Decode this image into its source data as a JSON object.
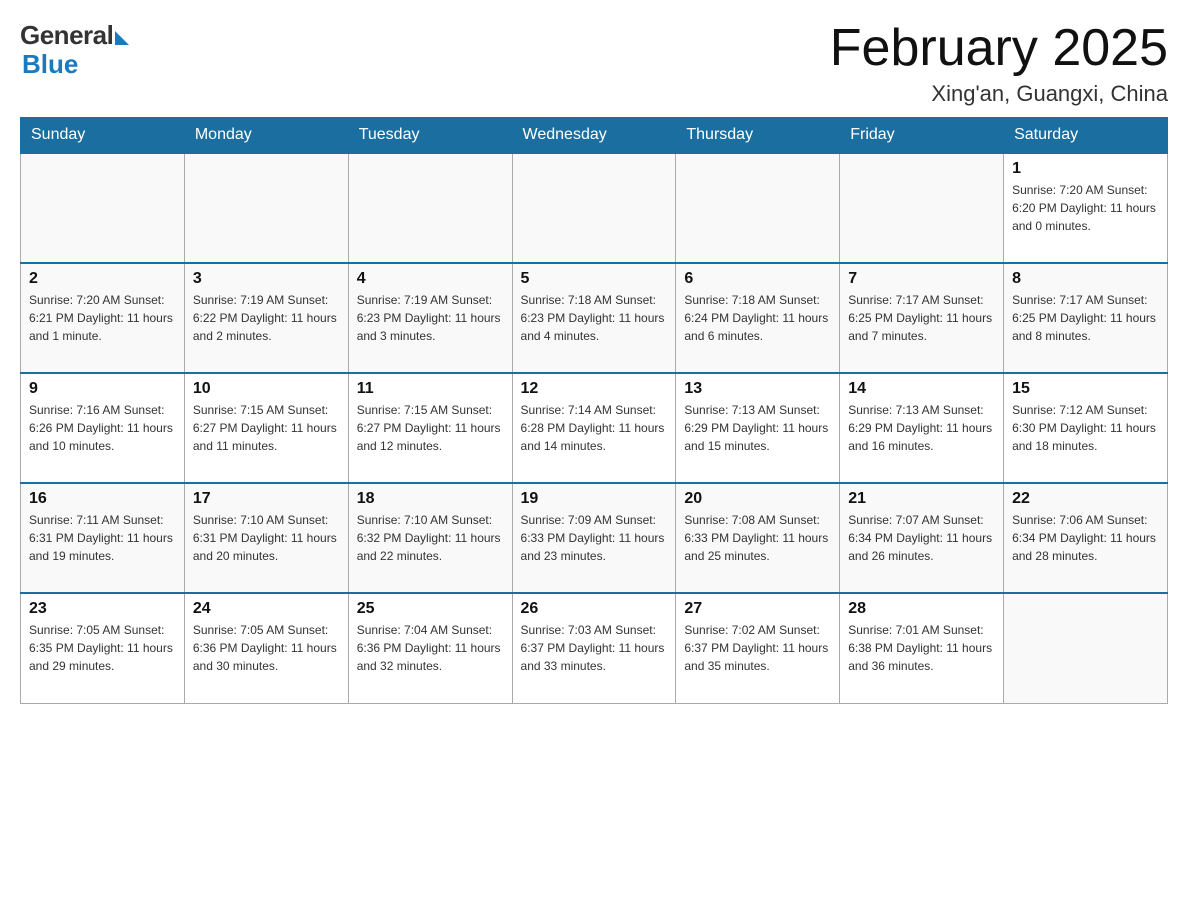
{
  "header": {
    "logo": {
      "general": "General",
      "blue": "Blue"
    },
    "title": "February 2025",
    "location": "Xing'an, Guangxi, China"
  },
  "weekdays": [
    "Sunday",
    "Monday",
    "Tuesday",
    "Wednesday",
    "Thursday",
    "Friday",
    "Saturday"
  ],
  "weeks": [
    [
      {
        "day": "",
        "info": ""
      },
      {
        "day": "",
        "info": ""
      },
      {
        "day": "",
        "info": ""
      },
      {
        "day": "",
        "info": ""
      },
      {
        "day": "",
        "info": ""
      },
      {
        "day": "",
        "info": ""
      },
      {
        "day": "1",
        "info": "Sunrise: 7:20 AM\nSunset: 6:20 PM\nDaylight: 11 hours and 0 minutes."
      }
    ],
    [
      {
        "day": "2",
        "info": "Sunrise: 7:20 AM\nSunset: 6:21 PM\nDaylight: 11 hours and 1 minute."
      },
      {
        "day": "3",
        "info": "Sunrise: 7:19 AM\nSunset: 6:22 PM\nDaylight: 11 hours and 2 minutes."
      },
      {
        "day": "4",
        "info": "Sunrise: 7:19 AM\nSunset: 6:23 PM\nDaylight: 11 hours and 3 minutes."
      },
      {
        "day": "5",
        "info": "Sunrise: 7:18 AM\nSunset: 6:23 PM\nDaylight: 11 hours and 4 minutes."
      },
      {
        "day": "6",
        "info": "Sunrise: 7:18 AM\nSunset: 6:24 PM\nDaylight: 11 hours and 6 minutes."
      },
      {
        "day": "7",
        "info": "Sunrise: 7:17 AM\nSunset: 6:25 PM\nDaylight: 11 hours and 7 minutes."
      },
      {
        "day": "8",
        "info": "Sunrise: 7:17 AM\nSunset: 6:25 PM\nDaylight: 11 hours and 8 minutes."
      }
    ],
    [
      {
        "day": "9",
        "info": "Sunrise: 7:16 AM\nSunset: 6:26 PM\nDaylight: 11 hours and 10 minutes."
      },
      {
        "day": "10",
        "info": "Sunrise: 7:15 AM\nSunset: 6:27 PM\nDaylight: 11 hours and 11 minutes."
      },
      {
        "day": "11",
        "info": "Sunrise: 7:15 AM\nSunset: 6:27 PM\nDaylight: 11 hours and 12 minutes."
      },
      {
        "day": "12",
        "info": "Sunrise: 7:14 AM\nSunset: 6:28 PM\nDaylight: 11 hours and 14 minutes."
      },
      {
        "day": "13",
        "info": "Sunrise: 7:13 AM\nSunset: 6:29 PM\nDaylight: 11 hours and 15 minutes."
      },
      {
        "day": "14",
        "info": "Sunrise: 7:13 AM\nSunset: 6:29 PM\nDaylight: 11 hours and 16 minutes."
      },
      {
        "day": "15",
        "info": "Sunrise: 7:12 AM\nSunset: 6:30 PM\nDaylight: 11 hours and 18 minutes."
      }
    ],
    [
      {
        "day": "16",
        "info": "Sunrise: 7:11 AM\nSunset: 6:31 PM\nDaylight: 11 hours and 19 minutes."
      },
      {
        "day": "17",
        "info": "Sunrise: 7:10 AM\nSunset: 6:31 PM\nDaylight: 11 hours and 20 minutes."
      },
      {
        "day": "18",
        "info": "Sunrise: 7:10 AM\nSunset: 6:32 PM\nDaylight: 11 hours and 22 minutes."
      },
      {
        "day": "19",
        "info": "Sunrise: 7:09 AM\nSunset: 6:33 PM\nDaylight: 11 hours and 23 minutes."
      },
      {
        "day": "20",
        "info": "Sunrise: 7:08 AM\nSunset: 6:33 PM\nDaylight: 11 hours and 25 minutes."
      },
      {
        "day": "21",
        "info": "Sunrise: 7:07 AM\nSunset: 6:34 PM\nDaylight: 11 hours and 26 minutes."
      },
      {
        "day": "22",
        "info": "Sunrise: 7:06 AM\nSunset: 6:34 PM\nDaylight: 11 hours and 28 minutes."
      }
    ],
    [
      {
        "day": "23",
        "info": "Sunrise: 7:05 AM\nSunset: 6:35 PM\nDaylight: 11 hours and 29 minutes."
      },
      {
        "day": "24",
        "info": "Sunrise: 7:05 AM\nSunset: 6:36 PM\nDaylight: 11 hours and 30 minutes."
      },
      {
        "day": "25",
        "info": "Sunrise: 7:04 AM\nSunset: 6:36 PM\nDaylight: 11 hours and 32 minutes."
      },
      {
        "day": "26",
        "info": "Sunrise: 7:03 AM\nSunset: 6:37 PM\nDaylight: 11 hours and 33 minutes."
      },
      {
        "day": "27",
        "info": "Sunrise: 7:02 AM\nSunset: 6:37 PM\nDaylight: 11 hours and 35 minutes."
      },
      {
        "day": "28",
        "info": "Sunrise: 7:01 AM\nSunset: 6:38 PM\nDaylight: 11 hours and 36 minutes."
      },
      {
        "day": "",
        "info": ""
      }
    ]
  ]
}
